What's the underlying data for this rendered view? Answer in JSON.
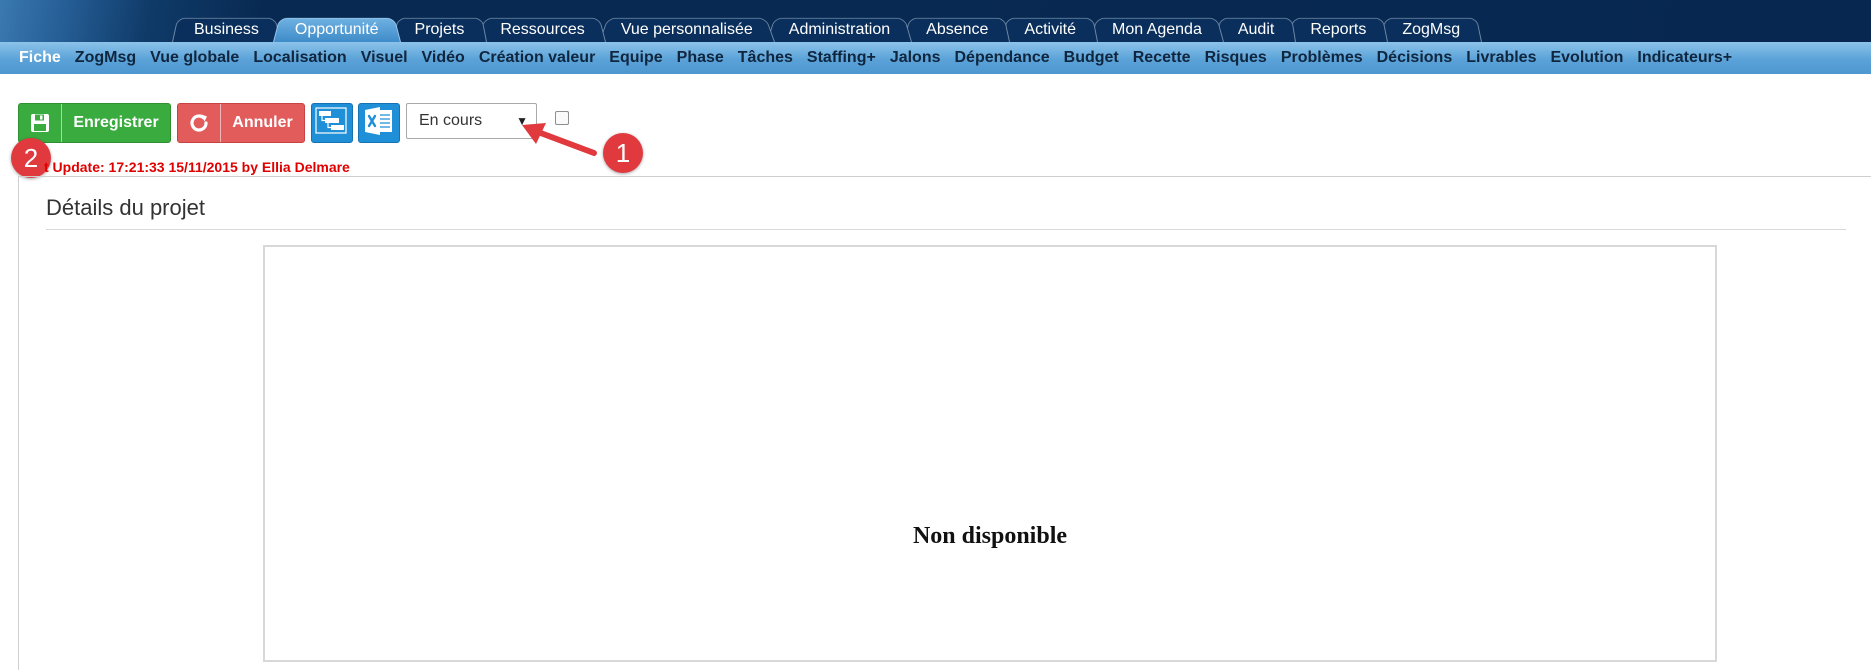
{
  "top_tabs": [
    {
      "label": "Business"
    },
    {
      "label": "Opportunité",
      "active": true
    },
    {
      "label": "Projets"
    },
    {
      "label": "Ressources"
    },
    {
      "label": "Vue personnalisée"
    },
    {
      "label": "Administration"
    },
    {
      "label": "Absence"
    },
    {
      "label": "Activité"
    },
    {
      "label": "Mon Agenda"
    },
    {
      "label": "Audit"
    },
    {
      "label": "Reports"
    },
    {
      "label": "ZogMsg"
    }
  ],
  "sub_menu": [
    {
      "label": "Fiche",
      "active": true
    },
    {
      "label": "ZogMsg"
    },
    {
      "label": "Vue globale"
    },
    {
      "label": "Localisation"
    },
    {
      "label": "Visuel"
    },
    {
      "label": "Vidéo"
    },
    {
      "label": "Création valeur"
    },
    {
      "label": "Equipe"
    },
    {
      "label": "Phase"
    },
    {
      "label": "Tâches"
    },
    {
      "label": "Staffing+"
    },
    {
      "label": "Jalons"
    },
    {
      "label": "Dépendance"
    },
    {
      "label": "Budget"
    },
    {
      "label": "Recette"
    },
    {
      "label": "Risques"
    },
    {
      "label": "Problèmes"
    },
    {
      "label": "Décisions"
    },
    {
      "label": "Livrables"
    },
    {
      "label": "Evolution"
    },
    {
      "label": "Indicateurs+"
    }
  ],
  "toolbar": {
    "save_label": "Enregistrer",
    "cancel_label": "Annuler",
    "status_value": "En cours"
  },
  "callouts": {
    "one": "1",
    "two": "2"
  },
  "last_update": "t Update: 17:21:33 15/11/2015 by Ellia Delmare",
  "section_title": "Détails du projet",
  "panel_text": "Non disponible",
  "colors": {
    "save": "#3aab3e",
    "cancel": "#e25c5c",
    "accent": "#1f8fd8",
    "callout": "#e0393e",
    "warning_text": "#e00000"
  }
}
